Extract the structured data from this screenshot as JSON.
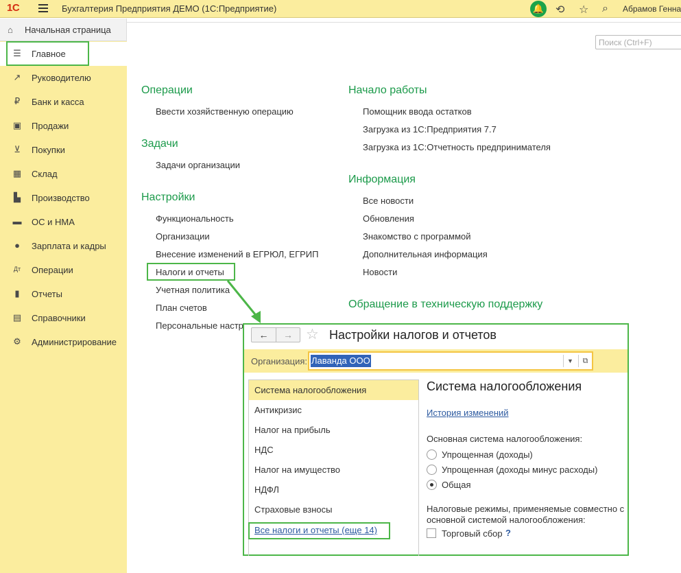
{
  "topbar": {
    "logo": "1С",
    "title": "Бухгалтерия Предприятия ДЕМО  (1С:Предприятие)",
    "user": "Абрамов Геннад",
    "icons": [
      "menu-icon",
      "bell-icon",
      "history-icon",
      "star-icon",
      "search-icon"
    ]
  },
  "sidebar": {
    "home_label": "Начальная страница",
    "items": [
      {
        "label": "Главное",
        "icon": "☰"
      },
      {
        "label": "Руководителю",
        "icon": "↗"
      },
      {
        "label": "Банк и касса",
        "icon": "₽"
      },
      {
        "label": "Продажи",
        "icon": "▣"
      },
      {
        "label": "Покупки",
        "icon": "⊻"
      },
      {
        "label": "Склад",
        "icon": "▦"
      },
      {
        "label": "Производство",
        "icon": "▙"
      },
      {
        "label": "ОС и НМА",
        "icon": "▬"
      },
      {
        "label": "Зарплата и кадры",
        "icon": "●"
      },
      {
        "label": "Операции",
        "icon": "Дт"
      },
      {
        "label": "Отчеты",
        "icon": "▮"
      },
      {
        "label": "Справочники",
        "icon": "▤"
      },
      {
        "label": "Администрирование",
        "icon": "⚙"
      }
    ]
  },
  "search": {
    "placeholder": "Поиск (Ctrl+F)"
  },
  "sections": {
    "operations": {
      "title": "Операции",
      "links": [
        "Ввести хозяйственную операцию"
      ]
    },
    "tasks": {
      "title": "Задачи",
      "links": [
        "Задачи организации"
      ]
    },
    "settings": {
      "title": "Настройки",
      "links": [
        "Функциональность",
        "Организации",
        "Внесение изменений в ЕГРЮЛ, ЕГРИП",
        "Налоги и отчеты",
        "Учетная политика",
        "План счетов",
        "Персональные настр"
      ]
    },
    "start": {
      "title": "Начало работы",
      "links": [
        "Помощник ввода остатков",
        "Загрузка из 1С:Предприятия 7.7",
        "Загрузка из 1С:Отчетность предпринимателя"
      ]
    },
    "info": {
      "title": "Информация",
      "links": [
        "Все новости",
        "Обновления",
        "Знакомство с программой",
        "Дополнительная информация",
        "Новости"
      ]
    },
    "support": {
      "title": "Обращение в техническую поддержку"
    }
  },
  "popup": {
    "title": "Настройки налогов и отчетов",
    "org_label": "Организация:",
    "org_value": "Лаванда ООО",
    "tax_items": [
      "Система налогообложения",
      "Антикризис",
      "Налог на прибыль",
      "НДС",
      "Налог на имущество",
      "НДФЛ",
      "Страховые взносы"
    ],
    "all_link": "Все налоги и отчеты (еще 14)",
    "right": {
      "title": "Система налогообложения",
      "history_link": "История изменений",
      "main_label": "Основная система налогообложения:",
      "options": [
        "Упрощенная (доходы)",
        "Упрощенная (доходы минус расходы)",
        "Общая"
      ],
      "selected": "Общая",
      "note": "Налоговые режимы, применяемые совместно с основной системой налогообложения:",
      "checkbox_label": "Торговый сбор",
      "help": "?"
    }
  }
}
